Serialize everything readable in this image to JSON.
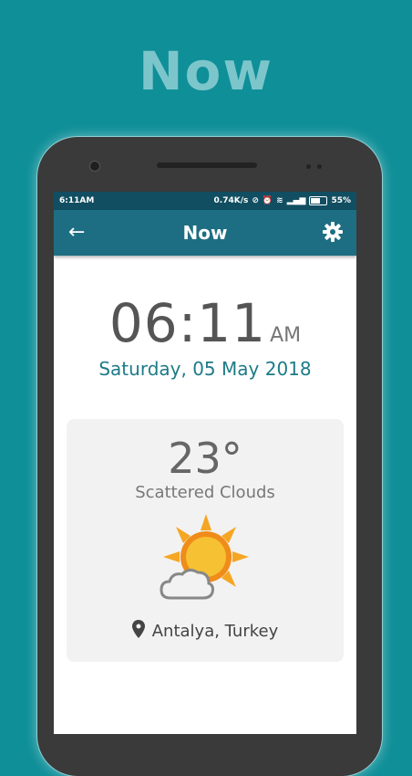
{
  "promo": {
    "title": "Now"
  },
  "status": {
    "time": "6:11AM",
    "speed": "0.74K/s",
    "battery": "55%"
  },
  "appbar": {
    "title": "Now",
    "back_icon": "arrow-back-icon",
    "settings_icon": "gear-icon"
  },
  "clock": {
    "time": "06:11",
    "ampm": "AM",
    "date": "Saturday, 05 May 2018"
  },
  "weather": {
    "temperature": "23°",
    "condition": "Scattered Clouds",
    "icon": "partly-cloudy-icon",
    "location": "Antalya, Turkey"
  },
  "colors": {
    "background": "#0f8f98",
    "appbar": "#1d6e82",
    "statusbar": "#114e61",
    "date": "#1d7b87",
    "sun": "#f5a623"
  }
}
